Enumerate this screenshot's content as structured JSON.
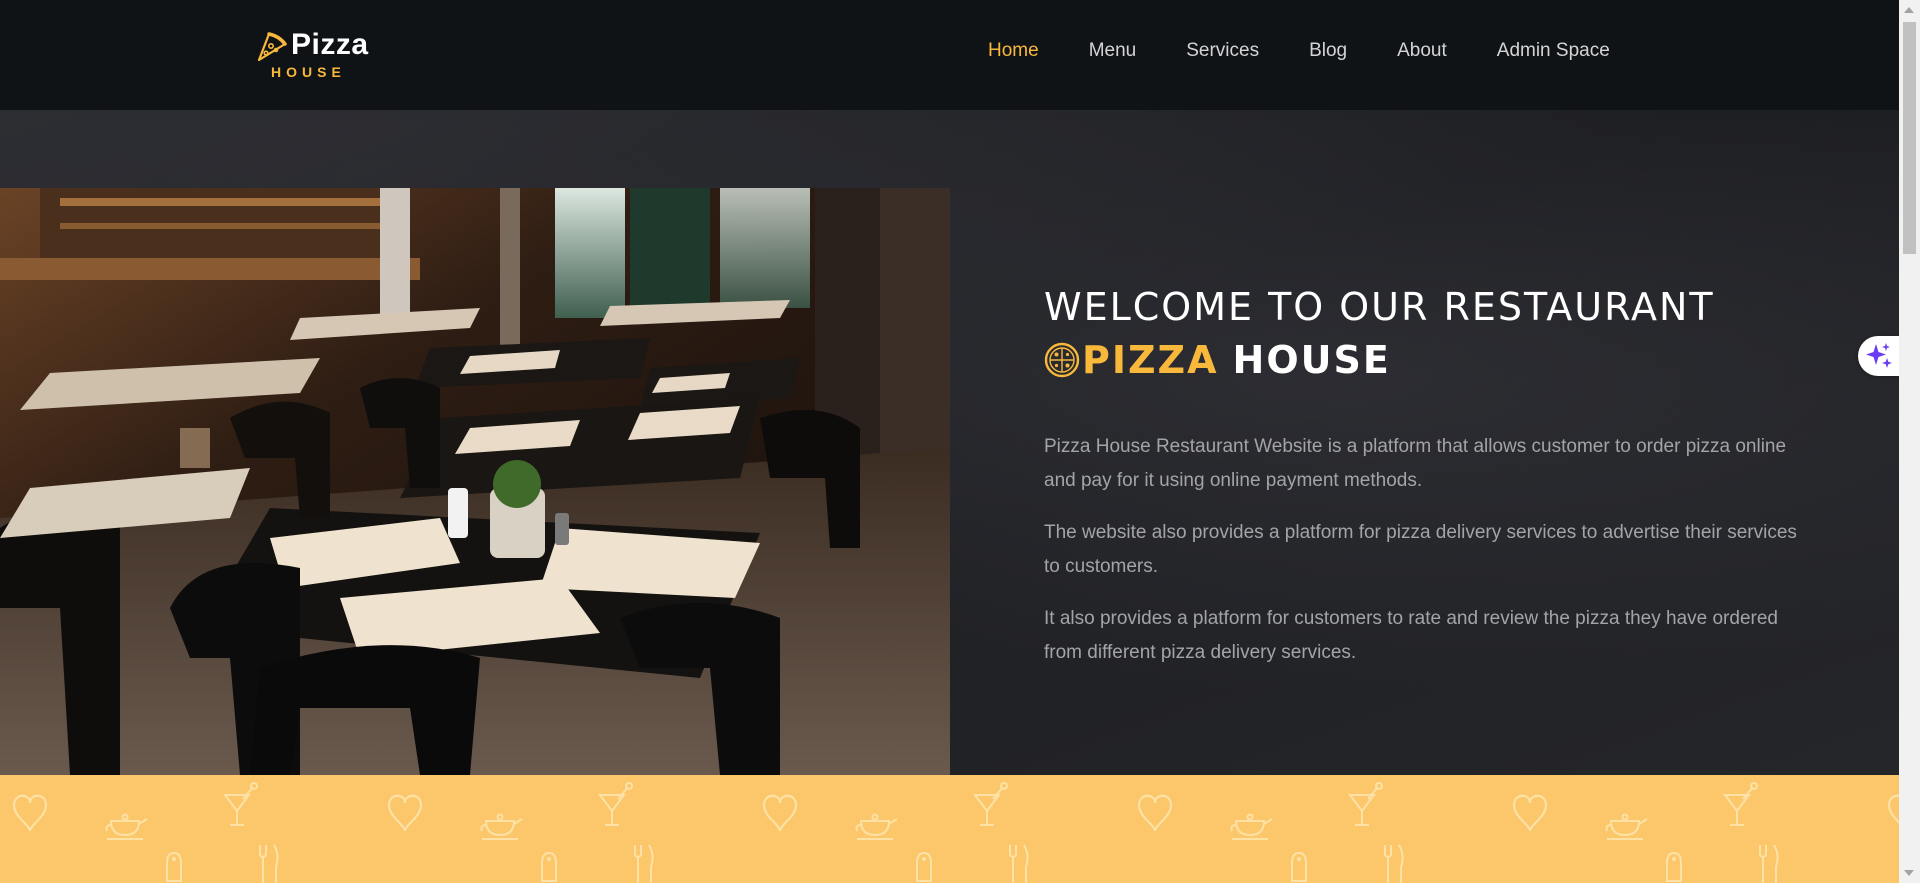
{
  "brand": {
    "name": "Pizza",
    "sub": "HOUSE",
    "accent_color": "#f8b83c",
    "icon": "pizza-slice-icon"
  },
  "nav": {
    "items": [
      {
        "label": "Home",
        "active": true
      },
      {
        "label": "Menu",
        "active": false
      },
      {
        "label": "Services",
        "active": false
      },
      {
        "label": "Blog",
        "active": false
      },
      {
        "label": "About",
        "active": false
      },
      {
        "label": "Admin Space",
        "active": false
      }
    ]
  },
  "hero": {
    "title_line1": "WELCOME TO OUR RESTAURANT",
    "title_accent": "PIZZA",
    "title_rest": "HOUSE",
    "paragraphs": [
      "Pizza House Restaurant Website is a platform that allows customer to order pizza online and pay for it using online payment methods.",
      "The website also provides a platform for pizza delivery services to advertise their services to customers.",
      "It also provides a platform for customers to rate and review the pizza they have ordered from different pizza delivery services."
    ],
    "image": "restaurant-interior-photo"
  },
  "strip": {
    "background": "#fbc76a",
    "pattern_icons": [
      "heart-icon",
      "teapot-icon",
      "cocktail-icon",
      "fork-knife-icon",
      "salt-shaker-icon"
    ]
  },
  "widget": {
    "icon": "sparkle-icon",
    "color": "#6b3df2"
  }
}
